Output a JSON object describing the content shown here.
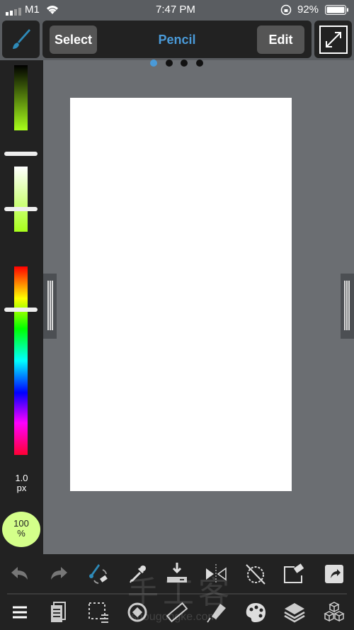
{
  "status": {
    "carrier": "M1",
    "time": "7:47 PM",
    "battery": "92%"
  },
  "topbar": {
    "select_label": "Select",
    "title": "Pencil",
    "edit_label": "Edit",
    "page_dots": 4,
    "active_page": 1,
    "accent": "#4a9ad8"
  },
  "left_panel": {
    "brush_size": "1.0",
    "brush_unit": "px",
    "opacity": "100",
    "opacity_unit": "%",
    "current_color": "#a8ff1a",
    "opacity_badge_color": "#d4ff8a"
  },
  "bottom_toolbar": {
    "row1": [
      "undo-icon",
      "redo-icon",
      "brush-eraser-swap-icon",
      "eyedropper-icon",
      "fill-icon",
      "mirror-icon",
      "rotate-off-icon",
      "clear-layer-icon",
      "share-icon"
    ],
    "row2": [
      "menu-icon",
      "pages-icon",
      "selection-icon",
      "snap-icon",
      "ruler-icon",
      "pen-fill-icon",
      "palette-icon",
      "layers-icon",
      "materials-icon"
    ]
  },
  "watermark": {
    "text": "手工客",
    "url": "shougongke.com"
  }
}
